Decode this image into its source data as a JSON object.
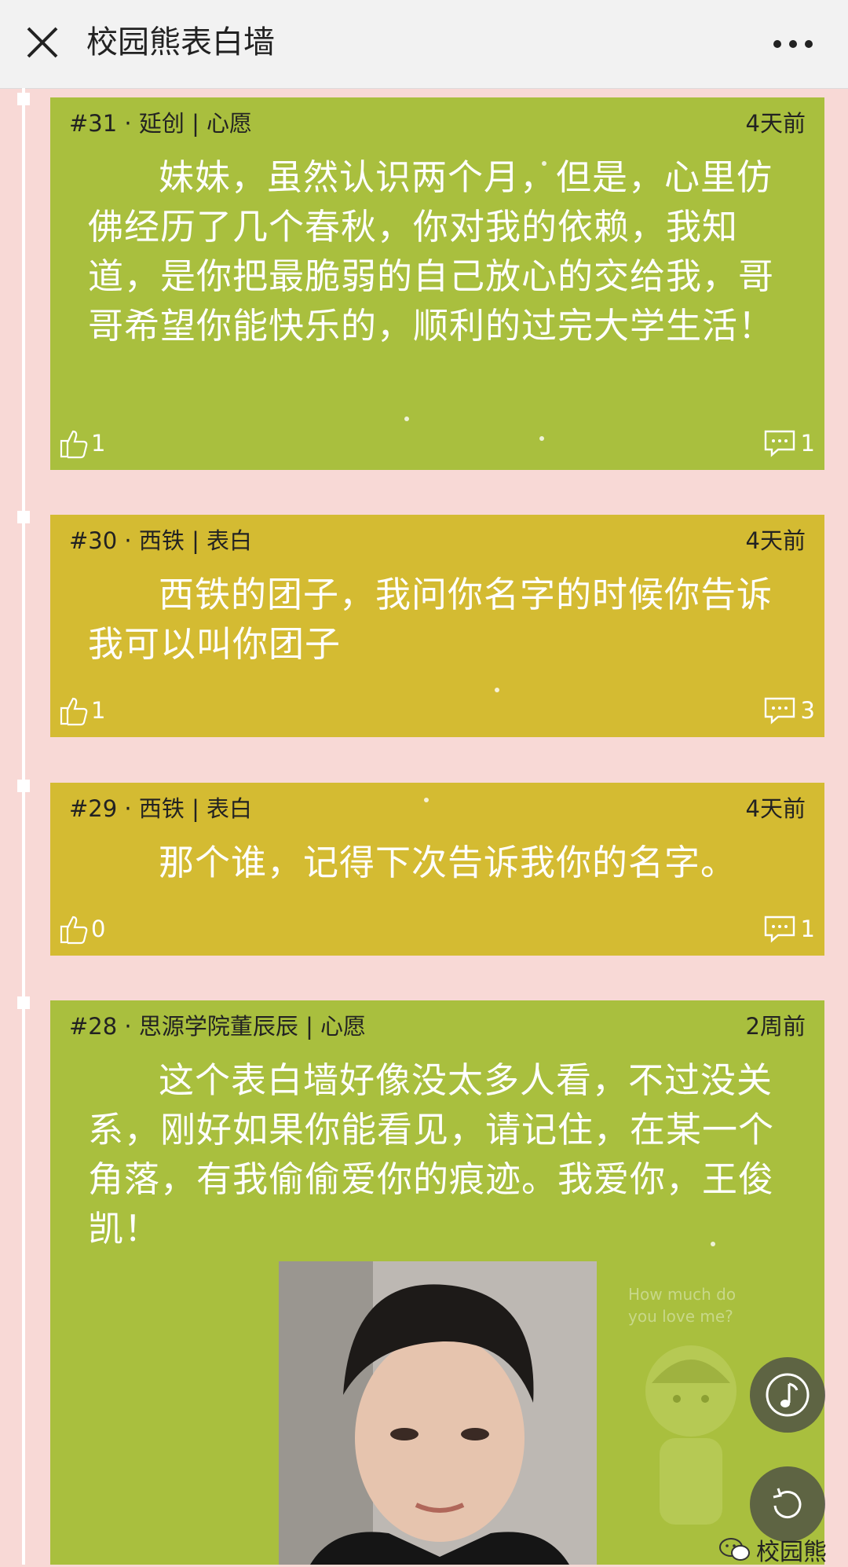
{
  "header": {
    "title": "校园熊表白墙",
    "close_icon": "close-icon",
    "more_icon": "more-dots-icon"
  },
  "posts": [
    {
      "meta": "#31 · 延创 | 心愿",
      "time": "4天前",
      "text": "妹妹，虽然认识两个月，但是，心里仿佛经历了几个春秋，你对我的依赖，我知道，是你把最脆弱的自己放心的交给我，哥哥希望你能快乐的，顺利的过完大学生活！",
      "likes": "1",
      "comments": "1",
      "color": "#a9bf3e"
    },
    {
      "meta": "#30 · 西铁 | 表白",
      "time": "4天前",
      "text": "西铁的团子，我问你名字的时候你告诉我可以叫你团子",
      "likes": "1",
      "comments": "3",
      "color": "#d4bb32"
    },
    {
      "meta": "#29 · 西铁 | 表白",
      "time": "4天前",
      "text": "那个谁，记得下次告诉我你的名字。",
      "likes": "0",
      "comments": "1",
      "color": "#d4bb32"
    },
    {
      "meta": "#28 · 思源学院董辰辰 | 心愿",
      "time": "2周前",
      "text": "这个表白墙好像没太多人看，不过没关系，刚好如果你能看见，请记住，在某一个角落，有我偷偷爱你的痕迹。我爱你，王俊凯！",
      "color": "#a9bf3e"
    }
  ],
  "background_text": "How much do you love me?",
  "floating": {
    "music_icon": "music-note-icon",
    "refresh_icon": "refresh-icon"
  },
  "brand": {
    "icon": "wechat-icon",
    "label": "校园熊"
  }
}
